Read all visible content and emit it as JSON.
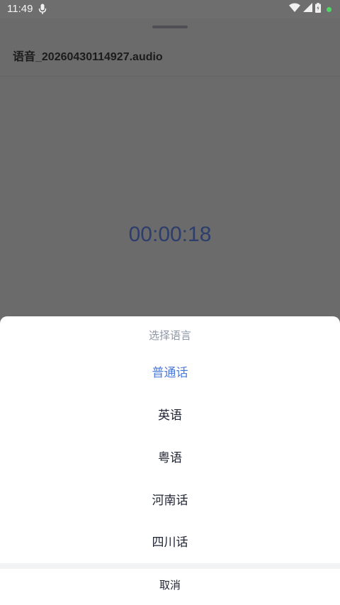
{
  "status_bar": {
    "time": "11:49",
    "icons": [
      "mic-icon",
      "wifi-icon",
      "signal-icon",
      "battery-icon",
      "dot-icon"
    ],
    "dot_color": "#4cd964"
  },
  "page": {
    "file_title": "语音_20260430114927.audio",
    "timer": "00:00:18"
  },
  "language_sheet": {
    "title": "选择语言",
    "options": [
      {
        "label": "普通话",
        "selected": true
      },
      {
        "label": "英语",
        "selected": false
      },
      {
        "label": "粤语",
        "selected": false
      },
      {
        "label": "河南话",
        "selected": false
      },
      {
        "label": "四川话",
        "selected": false
      }
    ],
    "cancel_label": "取消"
  },
  "colors": {
    "accent": "#4c7ad8",
    "timer": "#2d3d6c",
    "overlay": "#6e6e6e"
  }
}
